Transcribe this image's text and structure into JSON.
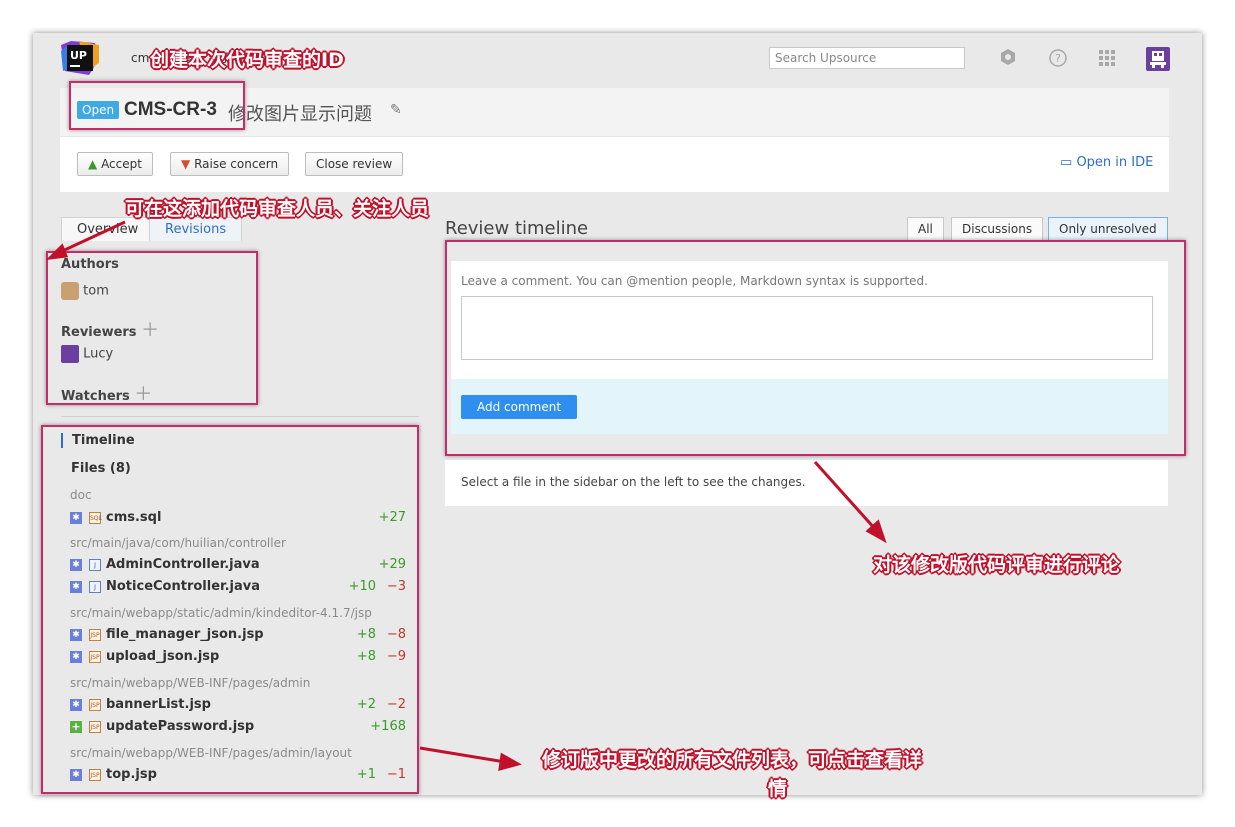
{
  "header": {
    "project": "cms 修改图片显示问题",
    "search_placeholder": "Search Upsource",
    "logo_text": "UP",
    "icons": [
      "settings-icon",
      "help-icon",
      "apps-grid-icon",
      "user-avatar-icon"
    ]
  },
  "review": {
    "status": "Open",
    "id": "CMS-CR-3",
    "title": "修改图片显示问题",
    "actions": {
      "accept": "Accept",
      "raise": "Raise concern",
      "close": "Close review"
    },
    "open_in_ide": "Open in IDE"
  },
  "left_tabs": [
    "Overview",
    "Revisions"
  ],
  "participants": {
    "authors_label": "Authors",
    "author": "tom",
    "reviewers_label": "Reviewers",
    "reviewer": "Lucy",
    "watchers_label": "Watchers"
  },
  "nav": {
    "timeline": "Timeline",
    "files": "Files (8)"
  },
  "file_groups": [
    {
      "dir": "doc",
      "files": [
        {
          "name": "cms.sql",
          "type": "SQL",
          "status": "modified",
          "add": "+27",
          "del": ""
        }
      ]
    },
    {
      "dir": "src/main/java/com/huilian/controller",
      "files": [
        {
          "name": "AdminController.java",
          "type": "J",
          "status": "modified",
          "add": "+29",
          "del": ""
        },
        {
          "name": "NoticeController.java",
          "type": "J",
          "status": "modified",
          "add": "+10",
          "del": "−3"
        }
      ]
    },
    {
      "dir": "src/main/webapp/static/admin/kindeditor-4.1.7/jsp",
      "files": [
        {
          "name": "file_manager_json.jsp",
          "type": "JSP",
          "status": "modified",
          "add": "+8",
          "del": "−8"
        },
        {
          "name": "upload_json.jsp",
          "type": "JSP",
          "status": "modified",
          "add": "+8",
          "del": "−9"
        }
      ]
    },
    {
      "dir": "src/main/webapp/WEB-INF/pages/admin",
      "files": [
        {
          "name": "bannerList.jsp",
          "type": "JSP",
          "status": "modified",
          "add": "+2",
          "del": "−2"
        },
        {
          "name": "updatePassword.jsp",
          "type": "JSP",
          "status": "added",
          "add": "+168",
          "del": ""
        }
      ]
    },
    {
      "dir": "src/main/webapp/WEB-INF/pages/admin/layout",
      "files": [
        {
          "name": "top.jsp",
          "type": "JSP",
          "status": "modified",
          "add": "+1",
          "del": "−1"
        }
      ]
    }
  ],
  "timeline": {
    "title": "Review timeline",
    "filters": [
      "All",
      "Discussions",
      "Only unresolved"
    ],
    "active_filter": "Only unresolved",
    "comment_hint": "Leave a comment. You can @mention people, Markdown syntax is supported.",
    "add_comment": "Add comment",
    "select_msg": "Select a file in the sidebar on the left to see the changes."
  },
  "annotations": {
    "create_id": "创建本次代码审查的ID",
    "add_people": "可在这添加代码审查人员、关注人员",
    "comment": "对该修改版代码评审进行评论",
    "files_1": "修订版中更改的所有文件列表，可点击查看详",
    "files_2": "情"
  },
  "colors": {
    "accent": "#2f6ec4",
    "annotation": "#c42b67",
    "badge": "#3fa9e4",
    "add_button": "#2e8ff0"
  }
}
